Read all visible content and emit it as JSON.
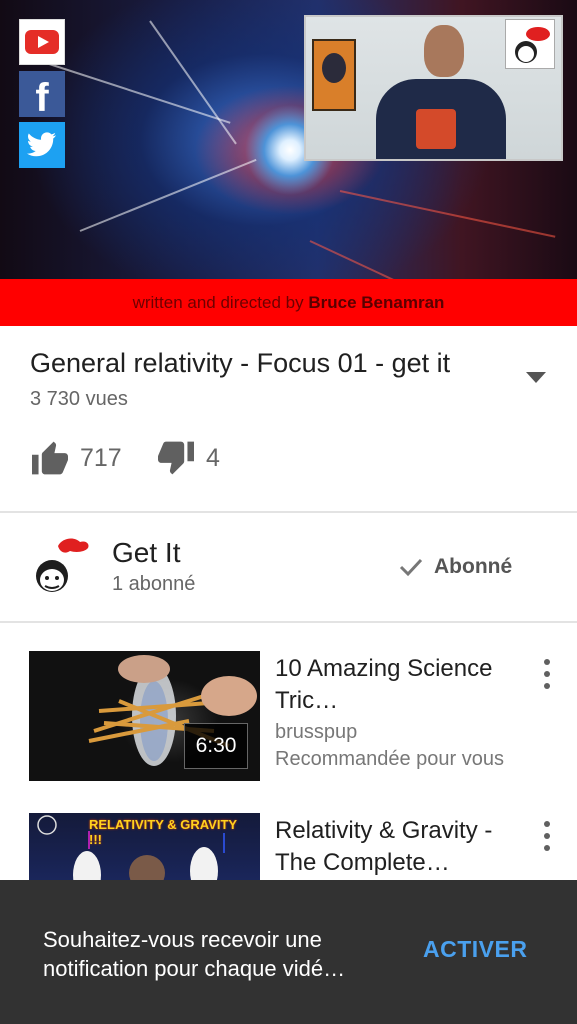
{
  "player": {
    "credit_prefix": "written and directed by",
    "credit_name": "Bruce Benamran",
    "social": [
      "youtube-icon",
      "facebook-icon",
      "twitter-icon"
    ]
  },
  "video": {
    "title": "General relativity - Focus 01 - get it",
    "views": "3 730 vues",
    "likes": "717",
    "dislikes": "4"
  },
  "channel": {
    "name": "Get It",
    "subscribers": "1 abonné",
    "subscribe_label": "Abonné"
  },
  "recommendations": [
    {
      "title": "10 Amazing Science Tric…",
      "channel": "brusspup",
      "note": "Recommandée pour vous",
      "duration": "6:30"
    },
    {
      "title": "Relativity & Gravity - The Complete…",
      "thumb_text": "RELATIVITY & GRAVITY !!!"
    }
  ],
  "snackbar": {
    "message": "Souhaitez-vous recevoir une notification pour chaque vidé…",
    "action": "ACTIVER"
  },
  "colors": {
    "credit_bar": "#ff0000",
    "snackbar_bg": "#323232",
    "action_blue": "#4aa0ee",
    "youtube_red": "#e52d27",
    "facebook_blue": "#3b5998",
    "twitter_blue": "#1da1f2"
  }
}
